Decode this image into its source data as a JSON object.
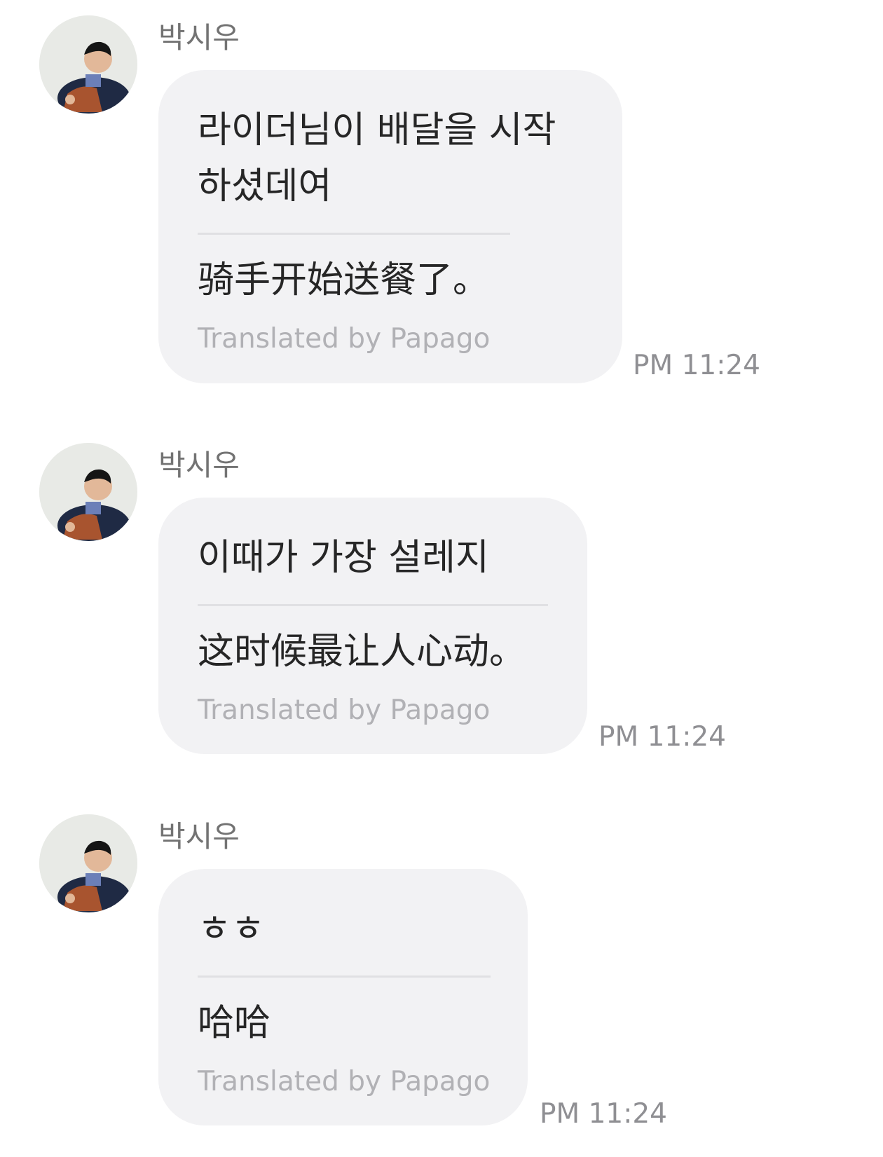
{
  "messages": [
    {
      "sender": "박시우",
      "original": "라이더님이 배달을 시작하셨데여",
      "translation": "骑手开始送餐了。",
      "credit": "Translated by Papago",
      "time": "PM 11:24"
    },
    {
      "sender": "박시우",
      "original": "이때가 가장 설레지",
      "translation": "这时候最让人心动。",
      "credit": "Translated by Papago",
      "time": "PM 11:24"
    },
    {
      "sender": "박시우",
      "original": "ㅎㅎ",
      "translation": "哈哈",
      "credit": "Translated by Papago",
      "time": "PM 11:24"
    }
  ],
  "colors": {
    "bubble": "#f2f2f4",
    "text": "#262626",
    "sender": "#737373",
    "credit": "#b1b1b5",
    "timestamp": "#8f8f93",
    "divider": "#e0e0e3"
  },
  "icons": {
    "avatar": "profile-photo-avatar"
  }
}
